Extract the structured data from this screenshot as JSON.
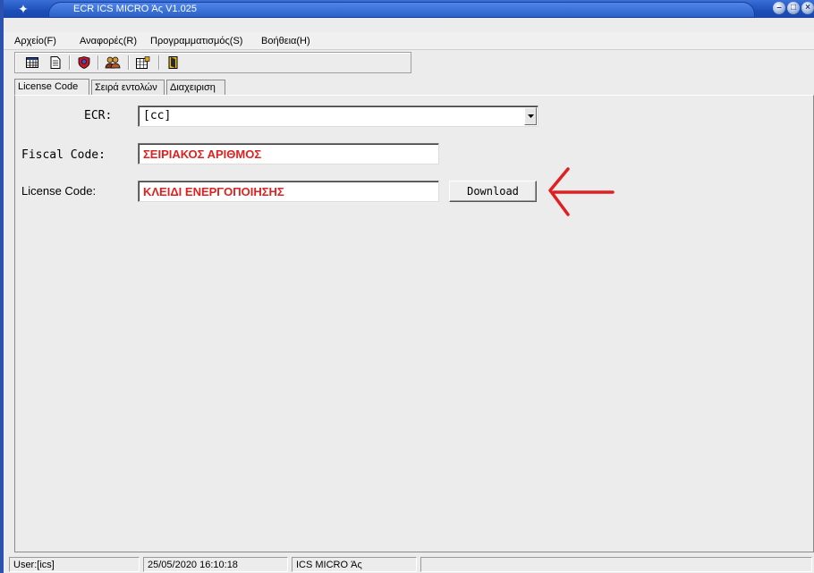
{
  "window": {
    "title": "ECR ICS MICRO Άς V1.025"
  },
  "menu": {
    "items": [
      {
        "label": "Αρχείο(F)"
      },
      {
        "label": "Αναφορές(R)"
      },
      {
        "label": "Προγραμματισμός(S)"
      },
      {
        "label": "Βοήθεια(H)"
      }
    ]
  },
  "toolbar": {
    "icons": [
      "calendar-grid-icon",
      "document-icon",
      "shield-settings-icon",
      "users-icon",
      "spreadsheet-icon",
      "exit-door-icon"
    ]
  },
  "tabs": [
    {
      "label": "License Code",
      "active": true
    },
    {
      "label": "Σειρά εντολών",
      "active": false
    },
    {
      "label": "Διαχειριση",
      "active": false
    }
  ],
  "form": {
    "ecr_label": "ECR:",
    "ecr_value": "[cc]",
    "fiscal_label": "Fiscal Code:",
    "fiscal_value": "ΣΕΙΡΙΑΚΟΣ ΑΡΙΘΜΟΣ",
    "license_label": "License Code:",
    "license_value": "ΚΛΕΙΔΙ ΕΝΕΡΓΟΠΟΙΗΣΗΣ",
    "download_label": "Download"
  },
  "annotation": {
    "arrow_color": "#e02020",
    "value_color": "#e02020"
  },
  "status": {
    "user": "User:[ics]",
    "datetime": "25/05/2020 16:10:18",
    "app": "ICS MICRO Άς",
    "extra": ""
  }
}
